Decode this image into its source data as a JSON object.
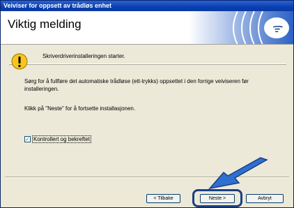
{
  "window": {
    "title": "Veiviser for oppsett av trådløs enhet"
  },
  "header": {
    "title": "Viktig melding",
    "logo_icon": "wireless-logo-icon"
  },
  "content": {
    "warning_icon": "warning-icon",
    "warning_text": "Skriverdriverinstalleringen starter.",
    "paragraph1": "Sørg for å fullføre det automatiske trådløse (ett-trykks) oppsettet i den forrige veiviseren før installeringen.",
    "paragraph2": "Klikk på \"Neste\" for å fortsette installasjonen.",
    "checkbox_label": "Kontrollert og bekreftet",
    "checkbox_checked": true
  },
  "buttons": {
    "back": "< Tilbake",
    "next": "Neste >",
    "cancel": "Avbryt"
  },
  "colors": {
    "titlebar": "#0a3fb0",
    "highlight": "#1a3f86",
    "arrow": "#2f6fd0"
  }
}
